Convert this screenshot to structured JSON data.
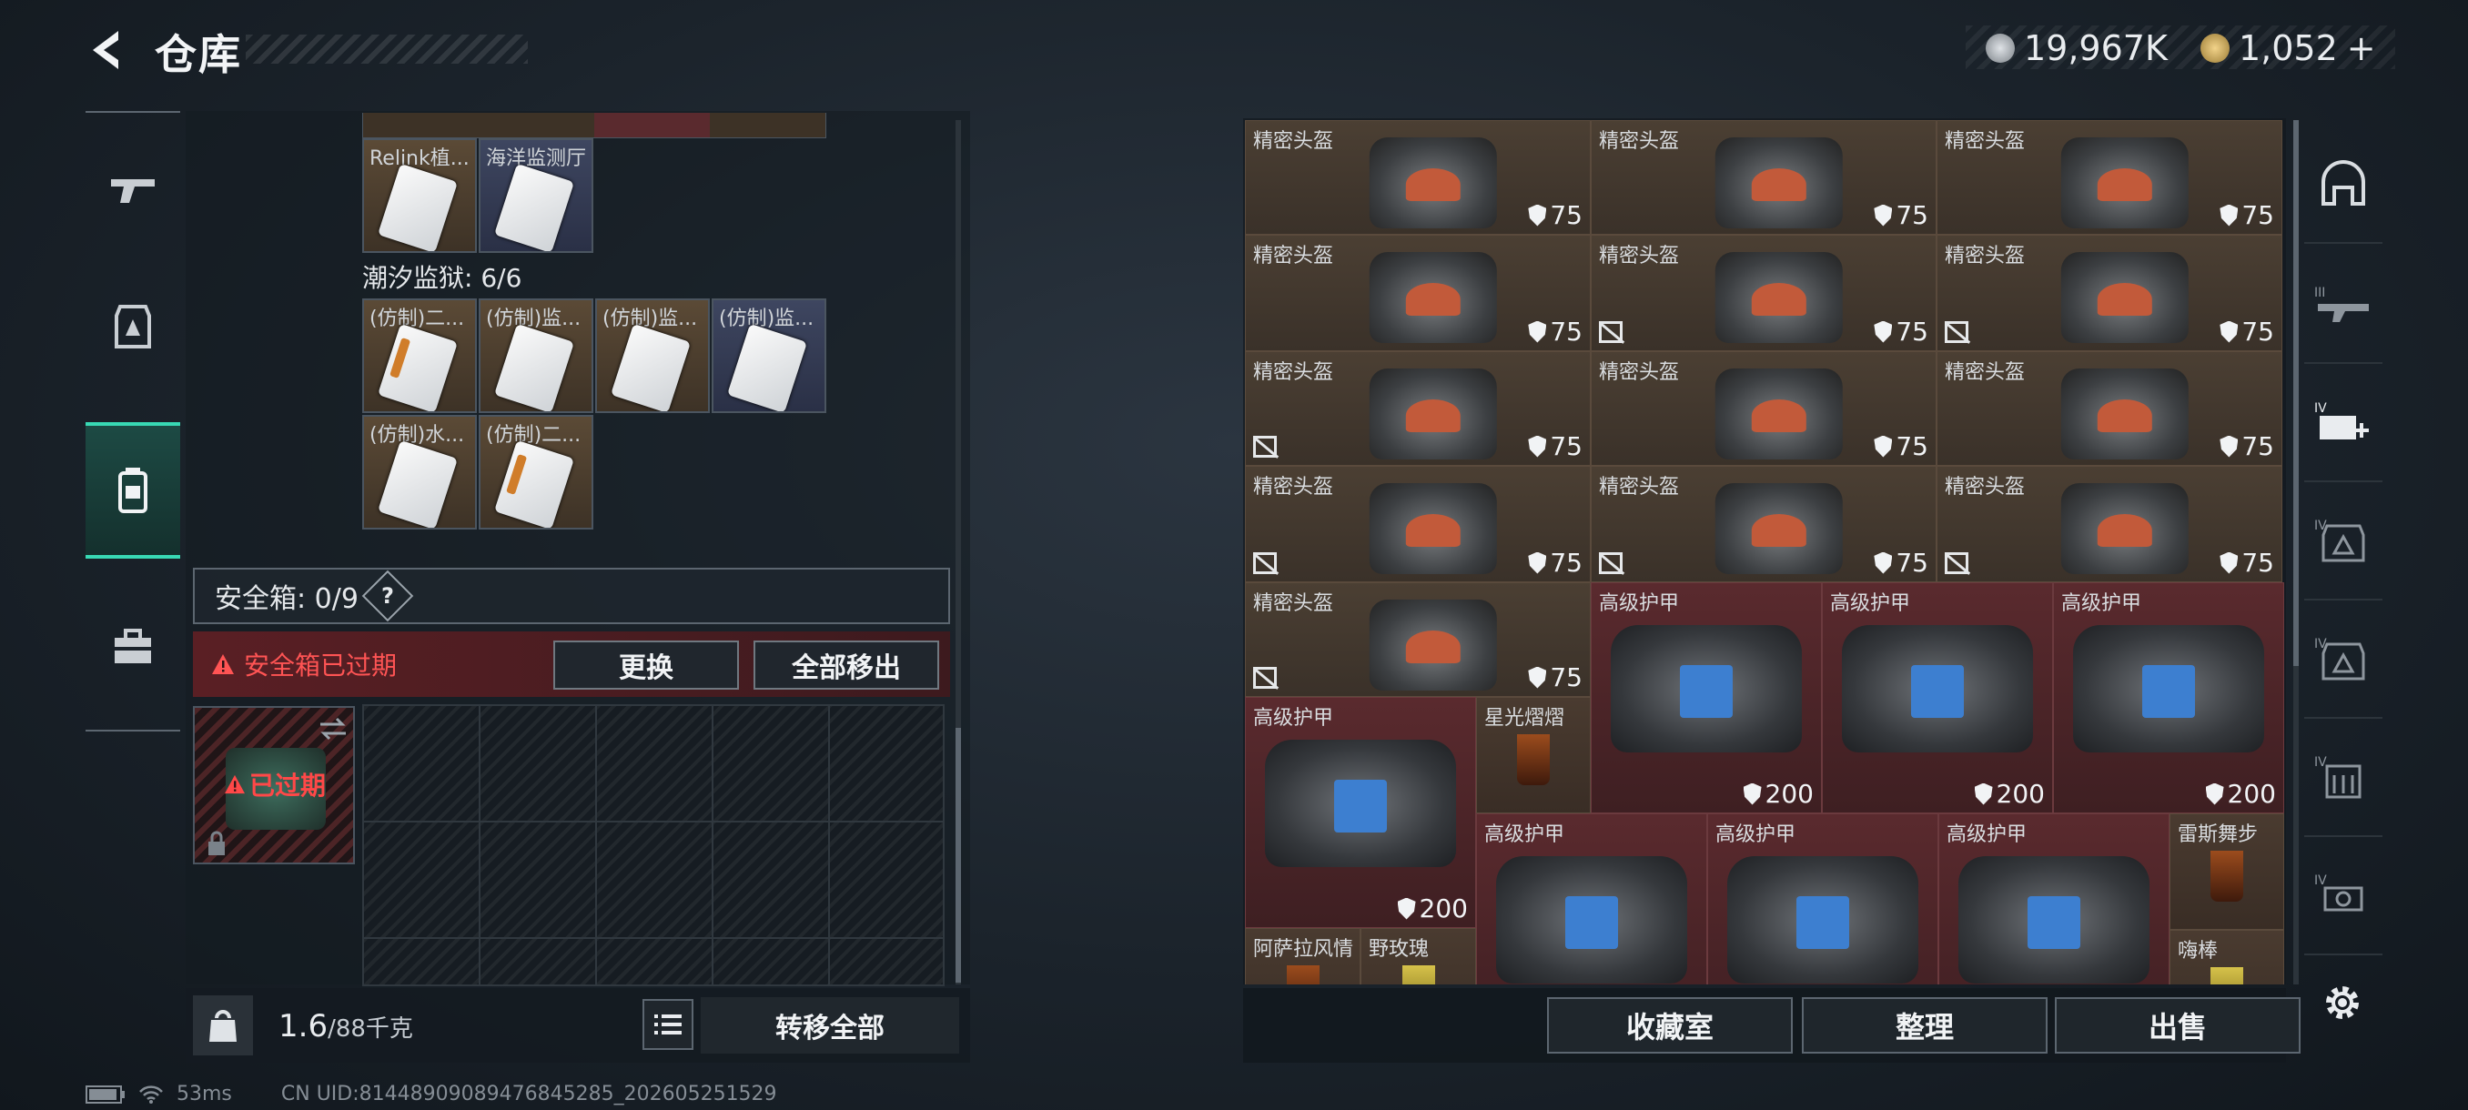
{
  "header": {
    "title": "仓库",
    "currency_primary": "19,967K",
    "currency_secondary": "1,052",
    "add_label": "+"
  },
  "left_nav": {
    "items": [
      {
        "name": "weapons",
        "icon": "gun-icon"
      },
      {
        "name": "armor",
        "icon": "armor-icon"
      },
      {
        "name": "backpack",
        "icon": "backpack-icon",
        "active": true
      },
      {
        "name": "case",
        "icon": "briefcase-icon"
      }
    ]
  },
  "stash": {
    "top_items": [
      {
        "label": "Relink植..."
      },
      {
        "label": "海洋监测厅"
      }
    ],
    "section_title": "潮汐监狱: 6/6",
    "section_items": [
      {
        "label": "(仿制)二..."
      },
      {
        "label": "(仿制)监..."
      },
      {
        "label": "(仿制)监..."
      },
      {
        "label": "(仿制)监..."
      },
      {
        "label": "(仿制)水..."
      },
      {
        "label": "(仿制)二..."
      }
    ],
    "safebox_label": "安全箱: 0/9",
    "safebox_help": "?",
    "expired_message": "安全箱已过期",
    "replace_button": "更换",
    "move_all_button": "全部移出",
    "case_status": "已过期",
    "weight_value": "1.6",
    "weight_max": "/88千克",
    "transfer_all_button": "转移全部"
  },
  "inventory": {
    "helmet_label": "精密头盔",
    "armor_label": "高级护甲",
    "helmet_value": "75",
    "armor_value": "200",
    "drinks": [
      {
        "label": "星光熠熠"
      },
      {
        "label": "雷斯舞步"
      },
      {
        "label": "阿萨拉风情"
      },
      {
        "label": "野玫瑰"
      },
      {
        "label": "嗨棒"
      }
    ]
  },
  "bottom_buttons": {
    "collection": "收藏室",
    "organize": "整理",
    "sell": "出售"
  },
  "status": {
    "ping": "53ms",
    "uid": "CN UID:81448909089476845285_202605251529"
  }
}
